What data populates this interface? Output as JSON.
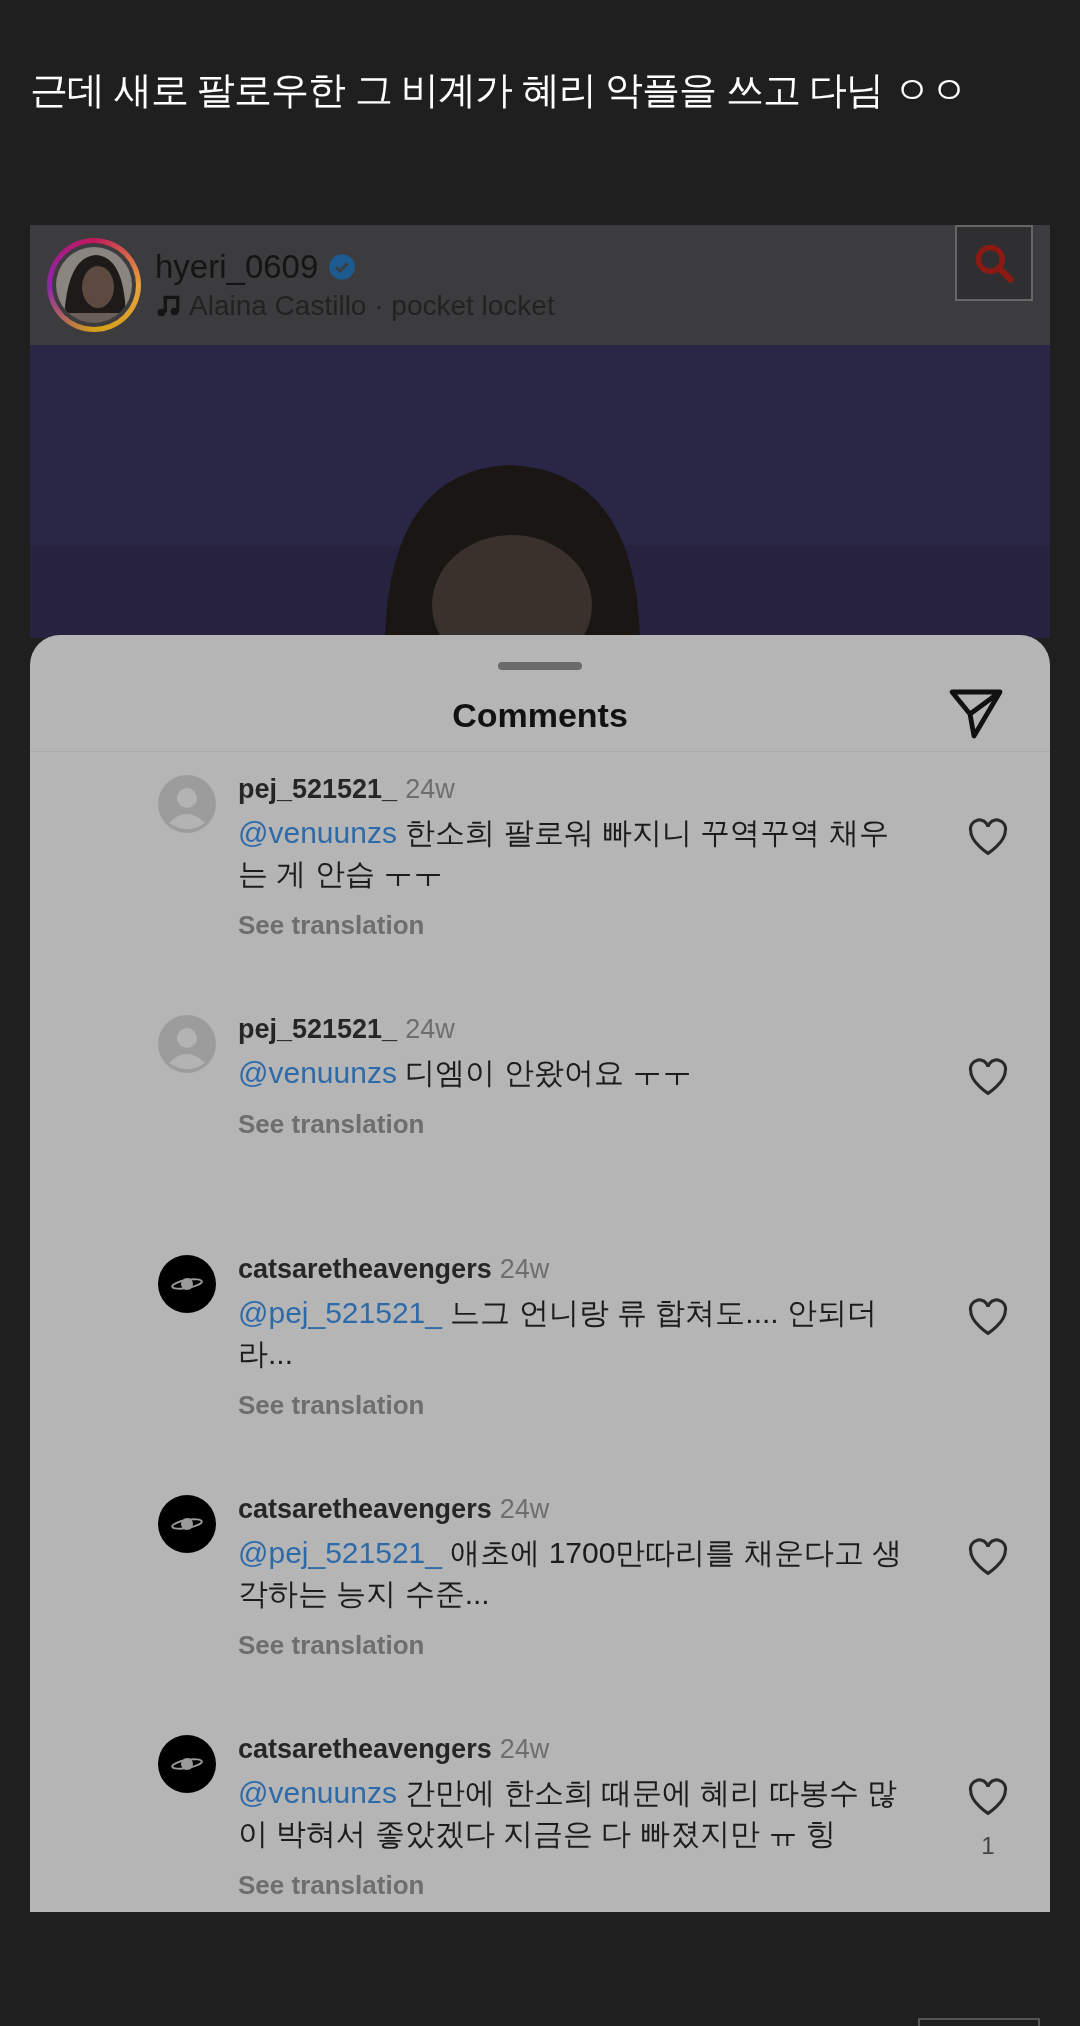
{
  "post_title": "근데 새로 팔로우한 그 비계가 혜리 악플을 쓰고 다님 ㅇㅇ",
  "screenshot": {
    "header": {
      "username": "hyeri_0609",
      "verified": true,
      "song": "Alaina Castillo · pocket locket"
    },
    "sheet": {
      "title": "Comments",
      "comments": [
        {
          "kind": "default",
          "username": "pej_521521_",
          "time": "24w",
          "mention": "@venuunzs",
          "text": "한소희 팔로워 빠지니 꾸역꾸역 채우는 게 안습 ㅜㅜ",
          "translation": "See translation"
        },
        {
          "kind": "default",
          "username": "pej_521521_",
          "time": "24w",
          "mention": "@venuunzs",
          "text": "디엠이 안왔어요 ㅜㅜ",
          "translation": "See translation"
        },
        {
          "kind": "planet",
          "username": "catsaretheavengers",
          "time": "24w",
          "mention": "@pej_521521_",
          "text": "느그 언니랑 류 합쳐도.... 안되더라...",
          "translation": "See translation"
        },
        {
          "kind": "planet",
          "username": "catsaretheavengers",
          "time": "24w",
          "mention": "@pej_521521_",
          "text": "애초에 1700만따리를 채운다고 생각하는 능지 수준...",
          "translation": "See translation"
        },
        {
          "kind": "planet",
          "username": "catsaretheavengers",
          "time": "24w",
          "mention": "@venuunzs",
          "text": "간만에 한소희 때문에 혜리 따봉수 많이 박혀서 좋았겠다 지금은 다 빠졌지만 ㅠ 힝",
          "translation": "See translation",
          "likes": "1"
        }
      ]
    }
  }
}
